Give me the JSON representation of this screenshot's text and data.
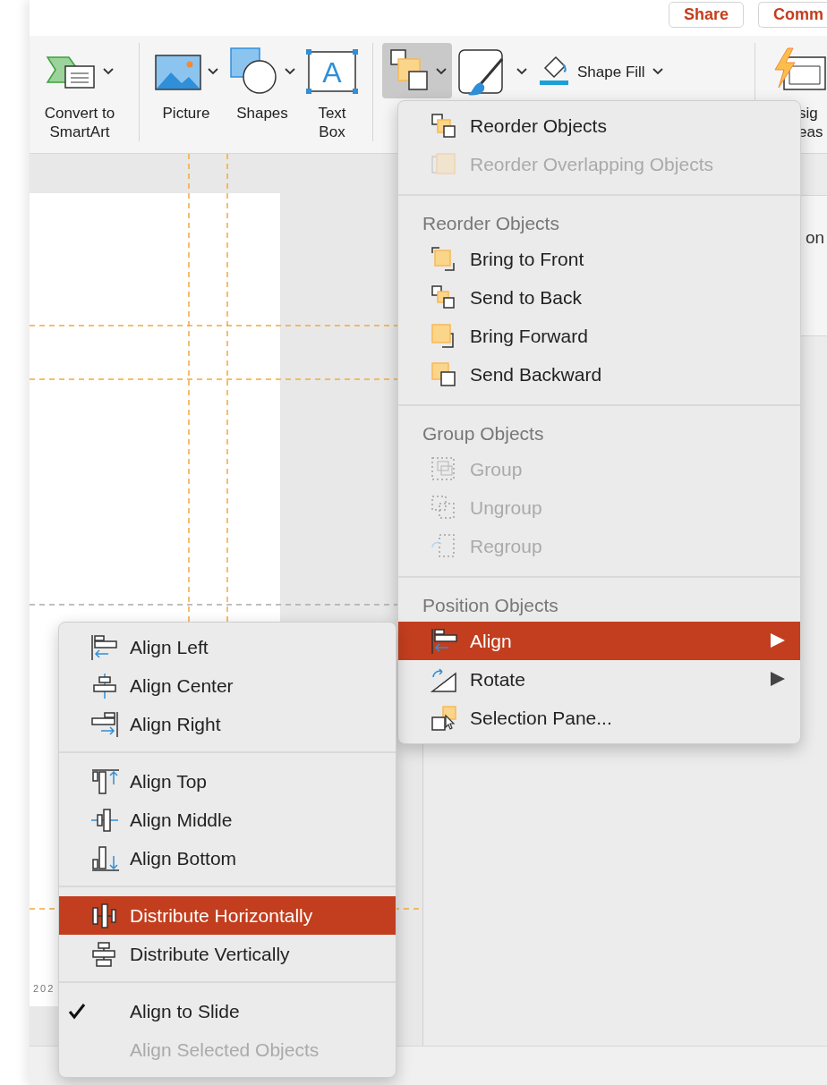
{
  "header_buttons": [
    {
      "label": "Share"
    },
    {
      "label": "Comm"
    }
  ],
  "ribbon": {
    "items": [
      {
        "kind": "smartart",
        "label": "Convert to SmartArt",
        "dropdown": true,
        "pressed": false
      },
      {
        "kind": "picture",
        "label": "Picture",
        "dropdown": true,
        "pressed": false
      },
      {
        "kind": "shapes",
        "label": "Shapes",
        "dropdown": true,
        "pressed": false
      },
      {
        "kind": "textbox",
        "label": "Text Box",
        "glyph": "A",
        "dropdown": false,
        "pressed": false
      },
      {
        "kind": "arrange",
        "dropdown": true,
        "pressed": true
      },
      {
        "kind": "styles",
        "dropdown": true,
        "pressed": false
      },
      {
        "kind": "fill",
        "label": "Shape Fill",
        "dropdown": true,
        "pressed": false
      },
      {
        "kind": "ideas",
        "label": "sig eas",
        "dropdown": false,
        "pressed": false
      }
    ]
  },
  "side_panel": {
    "text": "on"
  },
  "slide": {
    "footer_text": "202"
  },
  "arrange_menu": {
    "sections": [
      {
        "items": [
          {
            "kind": "reorder",
            "label": "Reorder Objects",
            "disabled": false,
            "selected": false,
            "submenu": false
          },
          {
            "kind": "overlap",
            "label": "Reorder Overlapping Objects",
            "disabled": true,
            "selected": false,
            "submenu": false
          }
        ]
      },
      {
        "header": "Reorder Objects",
        "items": [
          {
            "kind": "front",
            "label": "Bring to Front",
            "disabled": false,
            "selected": false,
            "submenu": false
          },
          {
            "kind": "back",
            "label": "Send to Back",
            "disabled": false,
            "selected": false,
            "submenu": false
          },
          {
            "kind": "forward",
            "label": "Bring Forward",
            "disabled": false,
            "selected": false,
            "submenu": false
          },
          {
            "kind": "backward",
            "label": "Send Backward",
            "disabled": false,
            "selected": false,
            "submenu": false
          }
        ]
      },
      {
        "header": "Group Objects",
        "items": [
          {
            "kind": "group",
            "label": "Group",
            "disabled": true,
            "selected": false,
            "submenu": false
          },
          {
            "kind": "ungroup",
            "label": "Ungroup",
            "disabled": true,
            "selected": false,
            "submenu": false
          },
          {
            "kind": "regroup",
            "label": "Regroup",
            "disabled": true,
            "selected": false,
            "submenu": false
          }
        ]
      },
      {
        "header": "Position Objects",
        "items": [
          {
            "kind": "align",
            "label": "Align",
            "disabled": false,
            "selected": true,
            "submenu": true
          },
          {
            "kind": "rotate",
            "label": "Rotate",
            "disabled": false,
            "selected": false,
            "submenu": true
          },
          {
            "kind": "selection",
            "label": "Selection Pane...",
            "disabled": false,
            "selected": false,
            "submenu": false
          }
        ]
      }
    ]
  },
  "align_submenu": {
    "sections": [
      {
        "items": [
          {
            "kind": "left",
            "label": "Align Left",
            "disabled": false,
            "selected": false,
            "checked": false
          },
          {
            "kind": "center",
            "label": "Align Center",
            "disabled": false,
            "selected": false,
            "checked": false
          },
          {
            "kind": "right",
            "label": "Align Right",
            "disabled": false,
            "selected": false,
            "checked": false
          }
        ]
      },
      {
        "items": [
          {
            "kind": "top",
            "label": "Align Top",
            "disabled": false,
            "selected": false,
            "checked": false
          },
          {
            "kind": "middle",
            "label": "Align Middle",
            "disabled": false,
            "selected": false,
            "checked": false
          },
          {
            "kind": "bottom",
            "label": "Align Bottom",
            "disabled": false,
            "selected": false,
            "checked": false
          }
        ]
      },
      {
        "items": [
          {
            "kind": "disth",
            "label": "Distribute Horizontally",
            "disabled": false,
            "selected": true,
            "checked": false
          },
          {
            "kind": "distv",
            "label": "Distribute Vertically",
            "disabled": false,
            "selected": false,
            "checked": false
          }
        ]
      },
      {
        "items": [
          {
            "kind": "none",
            "label": "Align to Slide",
            "disabled": false,
            "selected": false,
            "checked": true
          },
          {
            "kind": "none",
            "label": "Align Selected Objects",
            "disabled": true,
            "selected": false,
            "checked": false
          }
        ]
      }
    ]
  }
}
